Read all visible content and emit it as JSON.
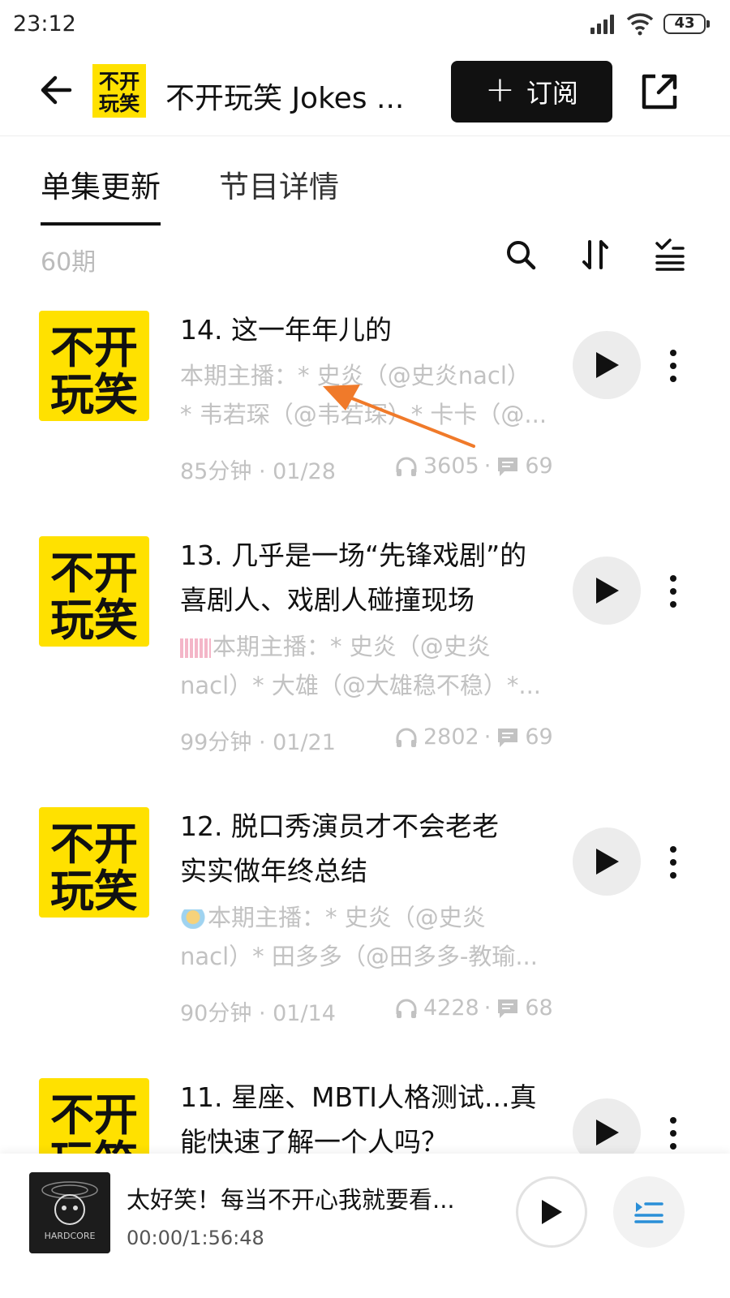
{
  "status_bar": {
    "time": "23:12",
    "battery": "43"
  },
  "header": {
    "title": "不开玩笑 Jokes ...",
    "subscribe_label": "订阅",
    "logo_text": "不开玩笑"
  },
  "tabs": [
    {
      "label": "单集更新",
      "active": true
    },
    {
      "label": "节目详情",
      "active": false
    }
  ],
  "toolbar": {
    "episode_count": "60期",
    "icons": [
      "search-icon",
      "sort-icon",
      "filter-list-icon"
    ]
  },
  "episodes": [
    {
      "title": "14. 这一年年儿的",
      "desc_line1": "本期主播：* 史炎（@史炎nacl）",
      "desc_line2": "* 韦若琛（@韦若琛）* 卡卡（@...",
      "duration_date": "85分钟 · 01/28",
      "plays": "3605",
      "sep": "·",
      "comments": "69"
    },
    {
      "title_line1": "13. 几乎是一场“先锋戏剧”的",
      "title_line2": "喜剧人、戏剧人碰撞现场",
      "desc_line1": "本期主播：* 史炎（@史炎",
      "desc_line2": "nacl）* 大雄（@大雄稳不稳）*...",
      "duration_date": "99分钟 · 01/21",
      "plays": "2802",
      "sep": "·",
      "comments": "69"
    },
    {
      "title_line1": "12. 脱口秀演员才不会老老",
      "title_line2": "实实做年终总结",
      "desc_line1": "本期主播：* 史炎（@史炎",
      "desc_line2": "nacl）* 田多多（@田多多-教瑜...",
      "duration_date": "90分钟 · 01/14",
      "plays": "4228",
      "sep": "·",
      "comments": "68"
    },
    {
      "title_line1": "11. 星座、MBTI人格测试...真",
      "title_line2": "能快速了解一个人吗？"
    }
  ],
  "mini_player": {
    "title": "太好笑！每当不开心我就要看...",
    "time": "00:00/1:56:48",
    "cover_text": "HARDCORE"
  },
  "colors": {
    "brand_yellow": "#FFE100",
    "annotation": "#F07A2A"
  }
}
